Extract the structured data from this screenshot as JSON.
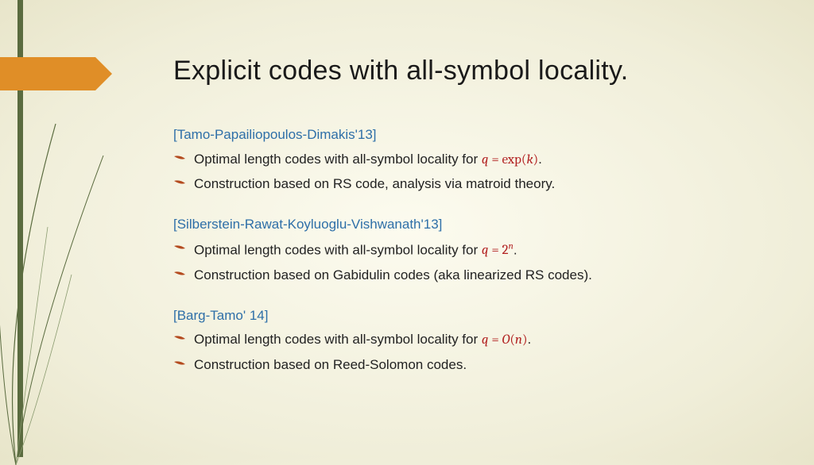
{
  "title": "Explicit codes with all-symbol locality.",
  "sections": [
    {
      "ref": "[Tamo-Papailiopoulos-Dimakis'13]",
      "bullets": [
        {
          "pre": "Optimal length codes with all-symbol locality for ",
          "math": "q = exp(k)",
          "post": "."
        },
        {
          "pre": "Construction based on RS code, analysis via matroid theory.",
          "math": "",
          "post": ""
        }
      ]
    },
    {
      "ref": "[Silberstein-Rawat-Koyluoglu-Vishwanath'13]",
      "bullets": [
        {
          "pre": "Optimal length codes with all-symbol locality for ",
          "math": "q = 2^n",
          "post": "."
        },
        {
          "pre": "Construction based on Gabidulin codes (aka linearized RS codes).",
          "math": "",
          "post": ""
        }
      ]
    },
    {
      "ref": "[Barg-Tamo' 14]",
      "bullets": [
        {
          "pre": "Optimal length codes with all-symbol locality for ",
          "math": "q = O(n)",
          "post": "."
        },
        {
          "pre": "Construction based on Reed-Solomon codes.",
          "math": "",
          "post": ""
        }
      ]
    }
  ]
}
